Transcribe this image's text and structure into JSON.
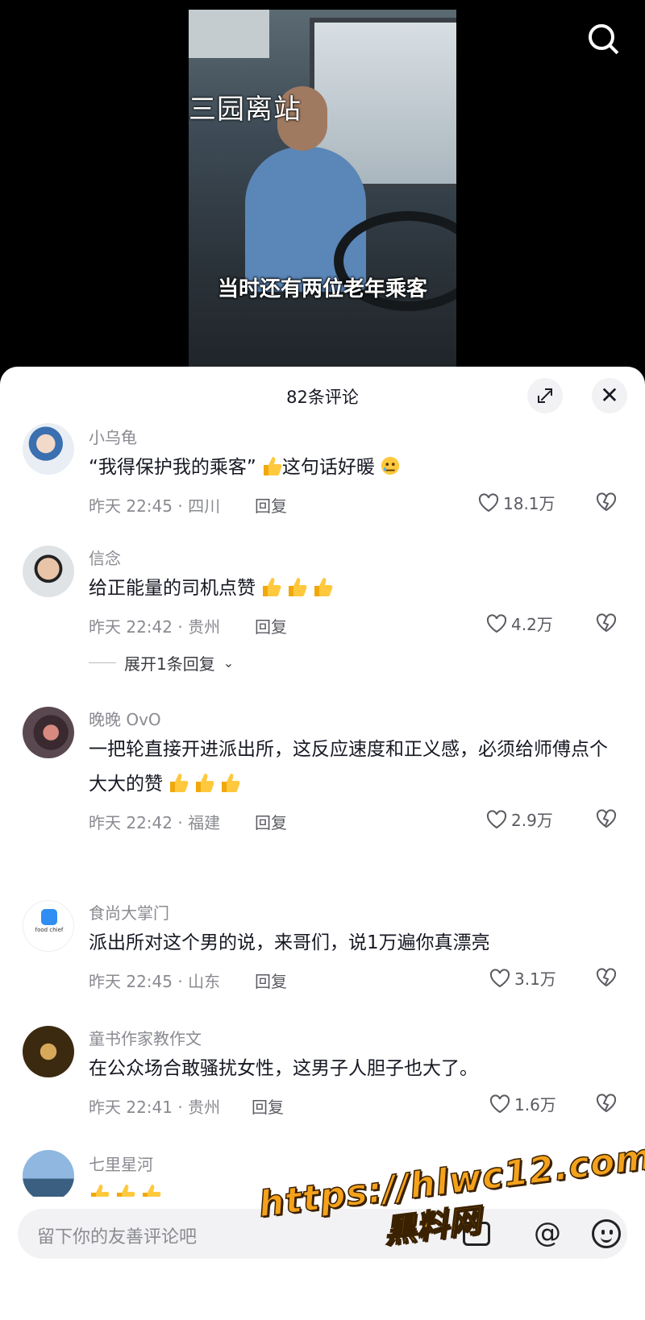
{
  "video": {
    "station_text": "三园离站",
    "caption": "当时还有两位老年乘客"
  },
  "sheet": {
    "title": "82条评论"
  },
  "comments": [
    {
      "username": "小乌龟",
      "text": "“我得保护我的乘客”",
      "text_after": "这句话好暖",
      "time_location": "昨天 22:45 · 四川",
      "reply_label": "回复",
      "likes": "18.1万"
    },
    {
      "username": "信念",
      "text": "给正能量的司机点赞",
      "time_location": "昨天 22:42 · 贵州",
      "reply_label": "回复",
      "likes": "4.2万",
      "expand_replies": "展开1条回复"
    },
    {
      "username": "晚晚 OvO",
      "text": "一把轮直接开进派出所，这反应速度和正义感，必须给师傅点个大大的赞",
      "time_location": "昨天 22:42 · 福建",
      "reply_label": "回复",
      "likes": "2.9万"
    },
    {
      "username": "食尚大掌门",
      "avatar_text": "food chief",
      "text": "派出所对这个男的说，来哥们，说1万遍你真漂亮",
      "time_location": "昨天 22:45 · 山东",
      "reply_label": "回复",
      "likes": "3.1万"
    },
    {
      "username": "童书作家教作文",
      "text": "在公众场合敢骚扰女性，这男子人胆子也大了。",
      "time_location": "昨天 22:41 · 贵州",
      "reply_label": "回复",
      "likes": "1.6万"
    },
    {
      "username": "七里星河"
    }
  ],
  "input": {
    "placeholder": "留下你的友善评论吧",
    "at_symbol": "@"
  },
  "watermark": {
    "url": "https://hlwc12.com",
    "name": "黑料网"
  },
  "colors": {
    "sheet_bg": "#ffffff",
    "muted_text": "#8a8b91",
    "primary_text": "#161823",
    "watermark": "#f4a21c"
  }
}
